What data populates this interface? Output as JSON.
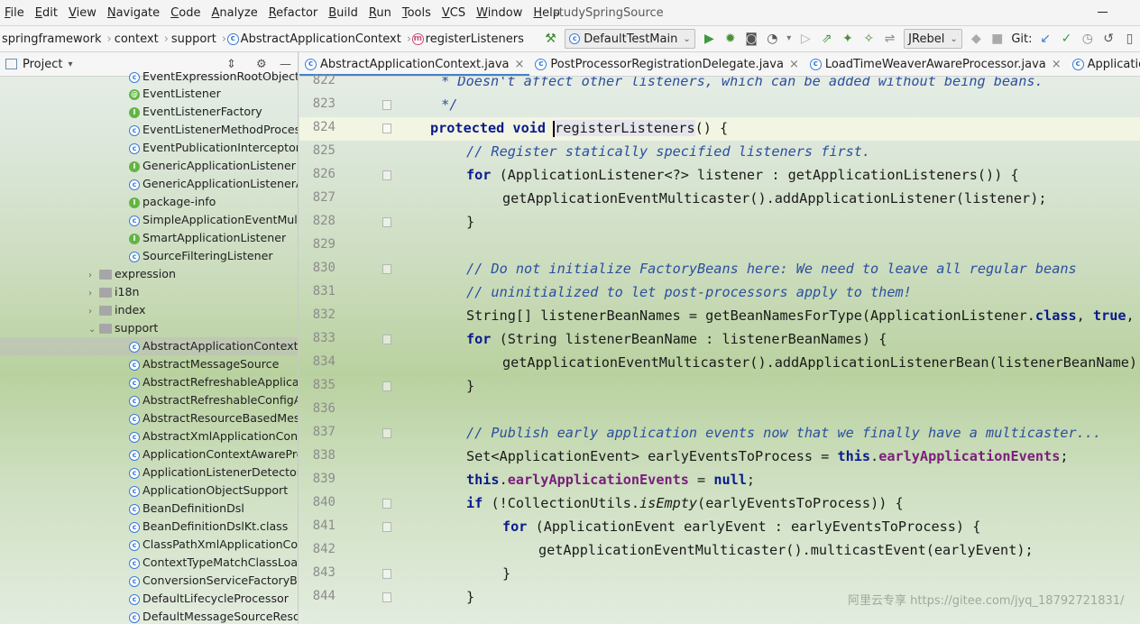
{
  "menu": [
    "File",
    "Edit",
    "View",
    "Navigate",
    "Code",
    "Analyze",
    "Refactor",
    "Build",
    "Run",
    "Tools",
    "VCS",
    "Window",
    "Help"
  ],
  "app_title": "studySpringSource",
  "breadcrumbs": [
    "springframework",
    "context",
    "support",
    "AbstractApplicationContext",
    "registerListeners"
  ],
  "run_config": "DefaultTestMain",
  "jrebel": "JRebel",
  "git_label": "Git:",
  "project_panel": {
    "title": "Project",
    "rows": [
      {
        "label": "EventExpressionRootObject",
        "icon": "c"
      },
      {
        "label": "EventListener",
        "icon": "at"
      },
      {
        "label": "EventListenerFactory",
        "icon": "i"
      },
      {
        "label": "EventListenerMethodProcessor",
        "icon": "c"
      },
      {
        "label": "EventPublicationInterceptor",
        "icon": "c"
      },
      {
        "label": "GenericApplicationListener",
        "icon": "i"
      },
      {
        "label": "GenericApplicationListenerAdapter",
        "icon": "c"
      },
      {
        "label": "package-info",
        "icon": "i"
      },
      {
        "label": "SimpleApplicationEventMulticaster",
        "icon": "c"
      },
      {
        "label": "SmartApplicationListener",
        "icon": "i"
      },
      {
        "label": "SourceFilteringListener",
        "icon": "c"
      },
      {
        "label": "expression",
        "icon": "folder"
      },
      {
        "label": "i18n",
        "icon": "folder"
      },
      {
        "label": "index",
        "icon": "folder"
      },
      {
        "label": "support",
        "icon": "folder-open"
      },
      {
        "label": "AbstractApplicationContext",
        "icon": "c"
      },
      {
        "label": "AbstractMessageSource",
        "icon": "c"
      },
      {
        "label": "AbstractRefreshableApplicationContext",
        "icon": "c"
      },
      {
        "label": "AbstractRefreshableConfigApplicationContext",
        "icon": "c"
      },
      {
        "label": "AbstractResourceBasedMessageSource",
        "icon": "c"
      },
      {
        "label": "AbstractXmlApplicationContext",
        "icon": "c"
      },
      {
        "label": "ApplicationContextAwareProcessor",
        "icon": "c"
      },
      {
        "label": "ApplicationListenerDetector",
        "icon": "c"
      },
      {
        "label": "ApplicationObjectSupport",
        "icon": "c"
      },
      {
        "label": "BeanDefinitionDsl",
        "icon": "c"
      },
      {
        "label": "BeanDefinitionDslKt.class",
        "icon": "c"
      },
      {
        "label": "ClassPathXmlApplicationContext",
        "icon": "c"
      },
      {
        "label": "ContextTypeMatchClassLoader",
        "icon": "c"
      },
      {
        "label": "ConversionServiceFactoryBean",
        "icon": "c"
      },
      {
        "label": "DefaultLifecycleProcessor",
        "icon": "c"
      },
      {
        "label": "DefaultMessageSourceResolvable",
        "icon": "c"
      }
    ]
  },
  "tabs": [
    "AbstractApplicationContext.java",
    "PostProcessorRegistrationDelegate.java",
    "LoadTimeWeaverAwareProcessor.java",
    "ApplicationListenerDetector.java"
  ],
  "line_numbers": [
    "822",
    "823",
    "824",
    "825",
    "826",
    "827",
    "828",
    "829",
    "830",
    "831",
    "832",
    "833",
    "834",
    "835",
    "836",
    "837",
    "838",
    "839",
    "840",
    "841",
    "842",
    "843",
    "844"
  ],
  "code": {
    "l822": " * Doesn't affect other listeners, which can be added without being beans.",
    "l823": " */",
    "l824a": "protected void ",
    "l824b": "registerListeners",
    "l824c": "() {",
    "l825": "// Register statically specified listeners first.",
    "l826a": "for",
    "l826b": " (ApplicationListener<?> listener : getApplicationListeners()) {",
    "l827": "getApplicationEventMulticaster().addApplicationListener(listener);",
    "l828": "}",
    "l830": "// Do not initialize FactoryBeans here: We need to leave all regular beans",
    "l831": "// uninitialized to let post-processors apply to them!",
    "l832a": "String[] listenerBeanNames = getBeanNamesForType(ApplicationListener.",
    "l832b": "class",
    "l832c": ", ",
    "l832d": "true",
    "l832e": ", ",
    "l832f": "false",
    "l832g": ");",
    "l833a": "for",
    "l833b": " (String listenerBeanName : listenerBeanNames) {",
    "l834": "getApplicationEventMulticaster().addApplicationListenerBean(listenerBeanName);",
    "l835": "}",
    "l837": "// Publish early application events now that we finally have a multicaster...",
    "l838a": "Set<ApplicationEvent> earlyEventsToProcess = ",
    "l838b": "this",
    "l838c": ".",
    "l838d": "earlyApplicationEvents",
    "l838e": ";",
    "l839a": "this",
    "l839b": ".",
    "l839c": "earlyApplicationEvents",
    "l839d": " = ",
    "l839e": "null",
    "l839f": ";",
    "l840a": "if",
    "l840b": " (!CollectionUtils.",
    "l840c": "isEmpty",
    "l840d": "(earlyEventsToProcess)) {",
    "l841a": "for",
    "l841b": " (ApplicationEvent earlyEvent : earlyEventsToProcess) {",
    "l842": "getApplicationEventMulticaster().multicastEvent(earlyEvent);",
    "l843": "}",
    "l844": "}"
  },
  "watermark": "阿里云专享 https://gitee.com/jyq_18792721831/",
  "colors": {
    "keyword": "#0a1a8c",
    "comment": "#7a7a7a",
    "field": "#7a1e7a",
    "accent": "#4083c9"
  }
}
